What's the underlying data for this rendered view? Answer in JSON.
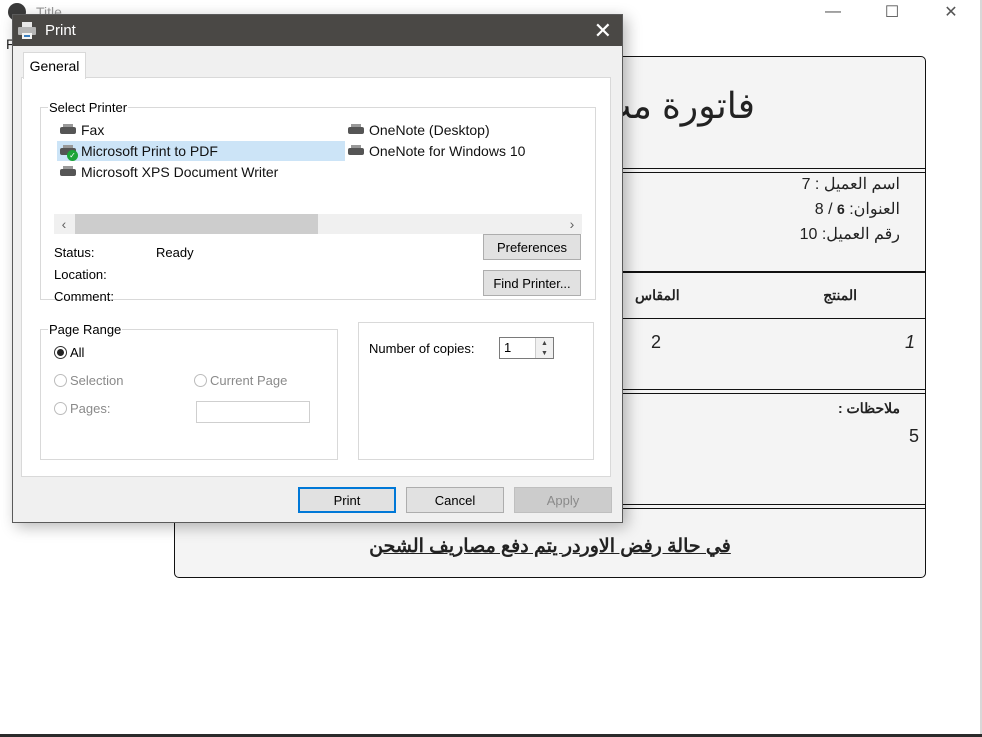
{
  "app": {
    "title": "Title",
    "partial_letter": "F",
    "window_controls": {
      "minimize": "—",
      "maximize": "☐",
      "close": "✕"
    }
  },
  "invoice": {
    "title": "فاتورة مب",
    "customer_name_line": "اسم العميل : 7",
    "address_label": "العنوان:",
    "address_bold": "6",
    "address_rest": "/ 8",
    "customer_number_line": "رقم العميل: 10",
    "columns": [
      "المنتج",
      "المقاس"
    ],
    "rows": [
      [
        "1",
        "2"
      ]
    ],
    "notes_label": "ملاحظات :",
    "notes_value": "5",
    "footer": "في حالة رفض الاوردر يتم دفع مصاريف الشحن"
  },
  "dialog": {
    "title": "Print",
    "close_glyph": "✕",
    "tabs": [
      {
        "label": "General",
        "active": true
      }
    ],
    "select_printer": {
      "legend": "Select Printer",
      "printers": [
        {
          "name": "Fax",
          "icon": "fax-printer-icon",
          "selected": false
        },
        {
          "name": "Microsoft Print to PDF",
          "icon": "default-printer-icon",
          "selected": true
        },
        {
          "name": "Microsoft XPS Document Writer",
          "icon": "printer-icon",
          "selected": false
        },
        {
          "name": "OneNote (Desktop)",
          "icon": "printer-icon",
          "selected": false
        },
        {
          "name": "OneNote for Windows 10",
          "icon": "printer-icon",
          "selected": false
        }
      ],
      "scroll_left": "‹",
      "scroll_right": "›",
      "status_label": "Status:",
      "status_value": "Ready",
      "location_label": "Location:",
      "location_value": "",
      "comment_label": "Comment:",
      "comment_value": "",
      "preferences_button": "Preferences",
      "find_printer_button": "Find Printer..."
    },
    "page_range": {
      "legend": "Page Range",
      "options": [
        {
          "label": "All",
          "checked": true,
          "enabled": true
        },
        {
          "label": "Selection",
          "checked": false,
          "enabled": false
        },
        {
          "label": "Current Page",
          "checked": false,
          "enabled": false
        },
        {
          "label": "Pages:",
          "checked": false,
          "enabled": false
        }
      ],
      "pages_value": ""
    },
    "copies": {
      "label": "Number of copies:",
      "value": "1",
      "up": "▲",
      "down": "▼"
    },
    "buttons": {
      "print": "Print",
      "cancel": "Cancel",
      "apply": "Apply"
    }
  }
}
